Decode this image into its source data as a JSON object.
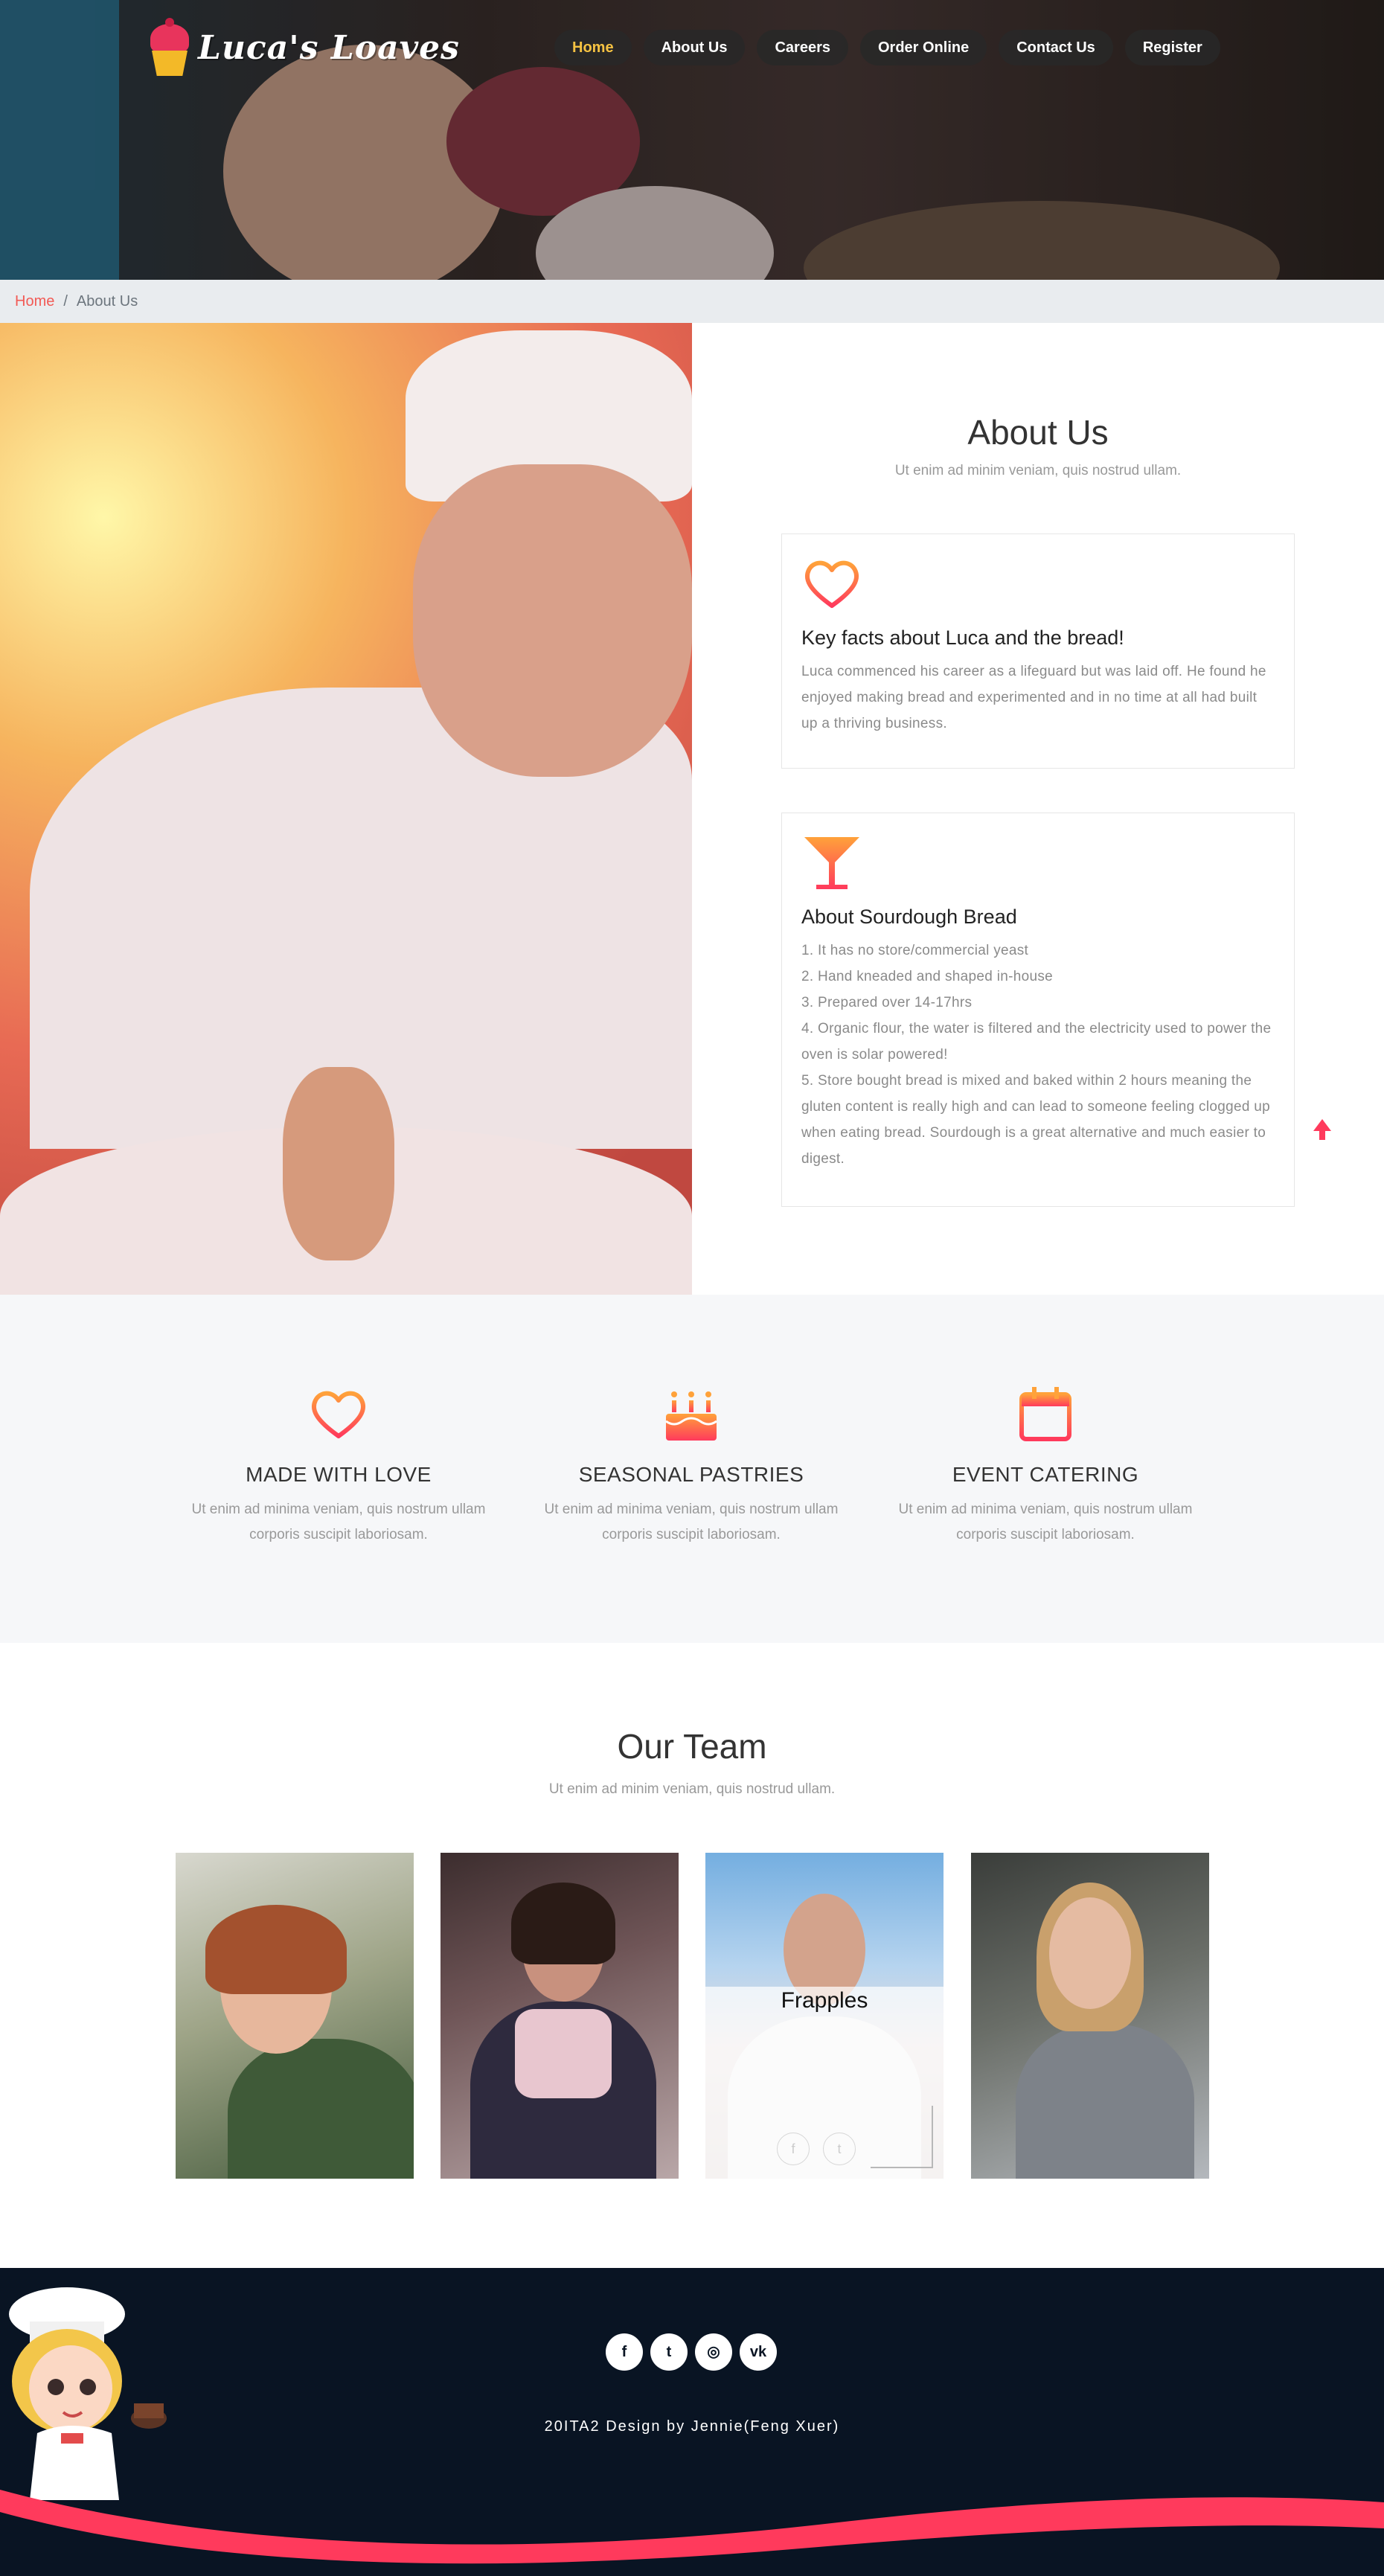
{
  "brand": {
    "name": "Luca's Loaves"
  },
  "nav": {
    "items": [
      {
        "label": "Home",
        "active": true
      },
      {
        "label": "About Us",
        "active": false
      },
      {
        "label": "Careers",
        "active": false
      },
      {
        "label": "Order Online",
        "active": false
      },
      {
        "label": "Contact Us",
        "active": false
      },
      {
        "label": "Register",
        "active": false
      }
    ]
  },
  "breadcrumb": {
    "home": "Home",
    "separator": "/",
    "current": "About Us"
  },
  "about": {
    "title": "About Us",
    "subtitle": "Ut enim ad minim veniam, quis nostrud ullam.",
    "cards": [
      {
        "icon": "heart-icon",
        "title": "Key facts about Luca and the bread!",
        "body": "Luca commenced his career as a lifeguard but was laid off. He found he enjoyed making bread and experimented and in no time at all had built up a thriving business."
      },
      {
        "icon": "cocktail-icon",
        "title": "About Sourdough Bread",
        "items": [
          "1. It has no store/commercial yeast",
          "2. Hand kneaded and shaped in-house",
          "3. Prepared over 14-17hrs",
          "4. Organic flour, the water is filtered and the electricity used to power the oven is solar powered!",
          "5. Store bought bread is mixed and baked within 2 hours meaning the gluten content is really high and can lead to someone feeling clogged up when eating bread. Sourdough is a great alternative and much easier to digest."
        ]
      }
    ]
  },
  "features": [
    {
      "icon": "heart-icon",
      "title": "MADE WITH LOVE",
      "body": "Ut enim ad minima veniam, quis nostrum ullam corporis suscipit laboriosam."
    },
    {
      "icon": "birthday-cake-icon",
      "title": "SEASONAL PASTRIES",
      "body": "Ut enim ad minima veniam, quis nostrum ullam corporis suscipit laboriosam."
    },
    {
      "icon": "calendar-icon",
      "title": "EVENT CATERING",
      "body": "Ut enim ad minima veniam, quis nostrum ullam corporis suscipit laboriosam."
    }
  ],
  "team": {
    "title": "Our Team",
    "subtitle": "Ut enim ad minim veniam, quis nostrud ullam.",
    "hovered_member": {
      "name": "Frapples",
      "social": [
        "f",
        "t"
      ]
    }
  },
  "footer": {
    "social": [
      {
        "icon": "facebook-icon",
        "glyph": "f"
      },
      {
        "icon": "twitter-icon",
        "glyph": "t"
      },
      {
        "icon": "dribbble-icon",
        "glyph": "◎"
      },
      {
        "icon": "vk-icon",
        "glyph": "vk"
      }
    ],
    "credit": "20ITA2 Design by Jennie(Feng Xuer)"
  },
  "colors": {
    "accent_pink": "#ff3a5c",
    "accent_orange": "#ff9a3c",
    "nav_active": "#f5c242",
    "footer_bg": "#091423",
    "breadcrumb_home": "#f25a55"
  }
}
